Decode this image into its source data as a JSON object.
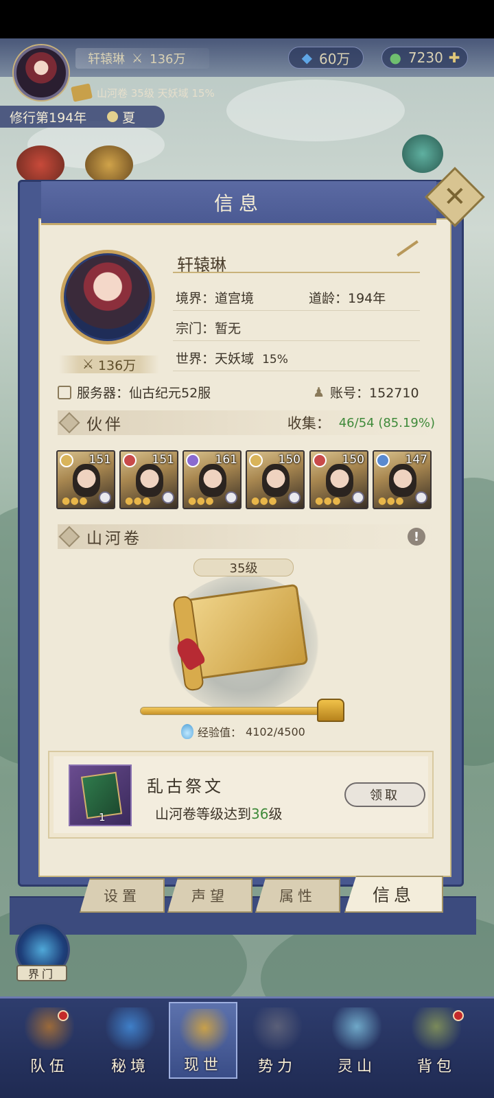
{
  "status": {
    "player_name": "轩辕琳",
    "combat_power": "136万",
    "currency_gem": "60万",
    "currency_jade": "7230",
    "realm_info": "山河卷 35级 天妖域 15%",
    "cultivation_year": "修行第194年",
    "season": "夏"
  },
  "panel": {
    "title": "信息",
    "close_icon": "close-x-icon",
    "profile": {
      "name": "轩辕琳",
      "power": "136万",
      "realm": "境界：道宫境",
      "age": "道龄：194年",
      "sect": "宗门：暂无",
      "world": "世界：天妖域",
      "world_pct": "15%",
      "server": "服务器：仙古纪元52服",
      "account": "账号：152710"
    },
    "partners": {
      "title": "伙伴",
      "collect_label": "收集：",
      "collect_value": "46/54 (85.19%)",
      "items": [
        {
          "level": "151",
          "element_color": "#d9b45a"
        },
        {
          "level": "151",
          "element_color": "#c84a4a"
        },
        {
          "level": "161",
          "element_color": "#8a6ad0"
        },
        {
          "level": "150",
          "element_color": "#d9b45a"
        },
        {
          "level": "150",
          "element_color": "#c84a4a"
        },
        {
          "level": "147",
          "element_color": "#5a8ad0"
        }
      ]
    },
    "scroll": {
      "title": "山河卷",
      "level": "35级",
      "exp_label": "经验值：",
      "exp_value": "4102/4500",
      "exp_fraction": 0.9116
    },
    "reward": {
      "title": "乱古祭文",
      "desc_prefix": "山河卷等级达到",
      "desc_level": "36",
      "desc_suffix": "级",
      "count": "1",
      "claim_label": "领取"
    },
    "tabs": [
      "设置",
      "声望",
      "属性",
      "信息"
    ]
  },
  "gate_label": "界门",
  "nav": [
    {
      "label": "队伍",
      "icon": "team-icon"
    },
    {
      "label": "秘境",
      "icon": "secret-realm-icon"
    },
    {
      "label": "现世",
      "icon": "world-icon"
    },
    {
      "label": "势力",
      "icon": "faction-icon"
    },
    {
      "label": "灵山",
      "icon": "spirit-mountain-icon"
    },
    {
      "label": "背包",
      "icon": "bag-icon"
    }
  ],
  "colors": {
    "panel_blue": "#48588f",
    "parchment": "#efe9d8",
    "accent_green": "#3f8a3a"
  }
}
